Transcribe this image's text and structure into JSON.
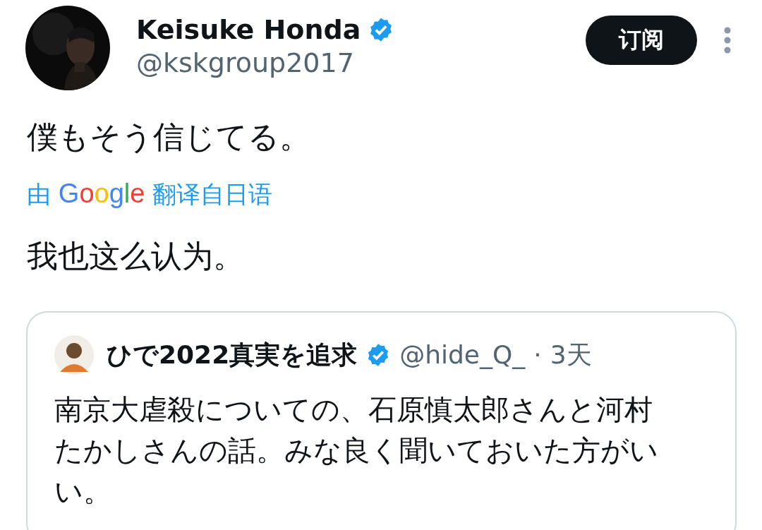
{
  "author": {
    "name": "Keisuke Honda",
    "verified": true,
    "handle": "@kskgroup2017"
  },
  "subscribe_button": "订阅",
  "tweet": {
    "text": "僕もそう信じてる。",
    "translation_credit": {
      "prefix": "由",
      "brand": "Google",
      "suffix": "翻译自日语"
    },
    "translation": "我也这么认为。"
  },
  "quoted_tweet": {
    "name": "ひで2022真実を追求",
    "verified": true,
    "handle": "@hide_Q_",
    "separator": "·",
    "time": "3天",
    "text": "南京大虐殺についての、石原慎太郎さんと河村たかしさんの話。みな良く聞いておいた方がいい。"
  }
}
